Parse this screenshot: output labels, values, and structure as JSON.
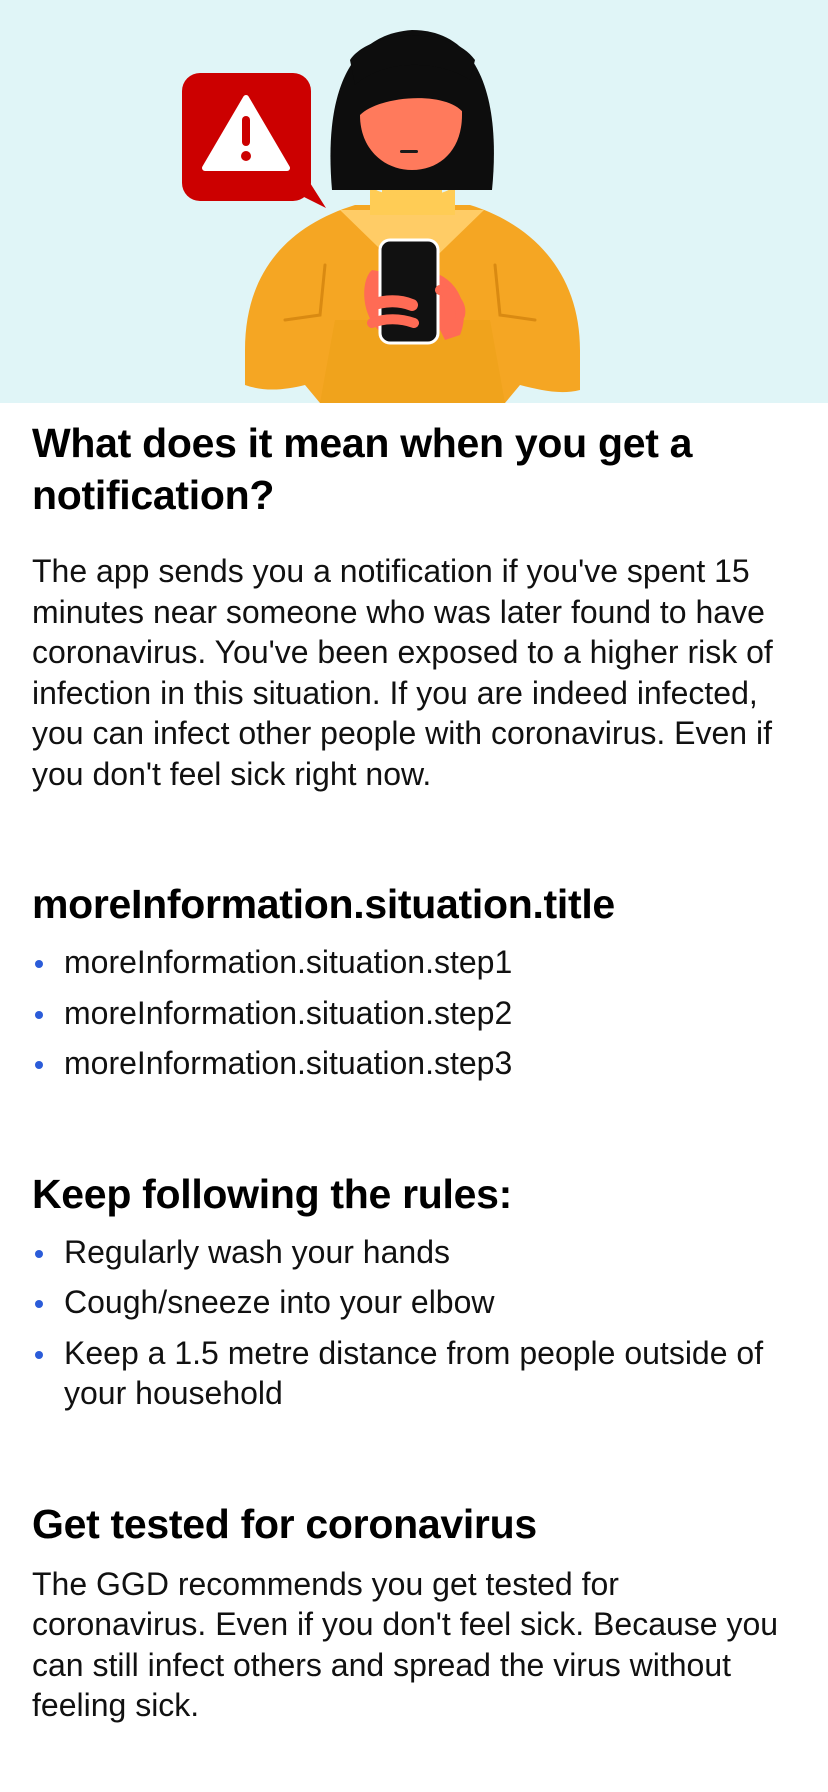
{
  "header_illustration": {
    "icon": "warning-speech-bubble-icon",
    "description_name": "person-holding-phone-illustration",
    "background_color": "#e0f5f7",
    "alert_color": "#cc0000"
  },
  "sections": {
    "meaning": {
      "title": "What does it mean when you get a notification?",
      "body": "The app sends you a notification if you've spent 15 minutes near someone who was later found to have coronavirus. You've been exposed to a higher risk of infection in this situation. If you are indeed infected, you can infect other people with coronavirus. Even if you don't feel sick right now."
    },
    "situation": {
      "title": "moreInformation.situation.title",
      "steps": [
        "moreInformation.situation.step1",
        "moreInformation.situation.step2",
        "moreInformation.situation.step3"
      ]
    },
    "rules": {
      "title": "Keep following the rules:",
      "items": [
        "Regularly wash your hands",
        "Cough/sneeze into your elbow",
        "Keep a 1.5 metre distance from people outside of your household"
      ]
    },
    "test": {
      "title": "Get tested for coronavirus",
      "body": "The GGD recommends you get tested for coronavirus. Even if you don't feel sick. Because you can still infect others and spread the virus without feeling sick."
    }
  },
  "colors": {
    "bullet": "#2b5cd9",
    "text": "#000000"
  }
}
